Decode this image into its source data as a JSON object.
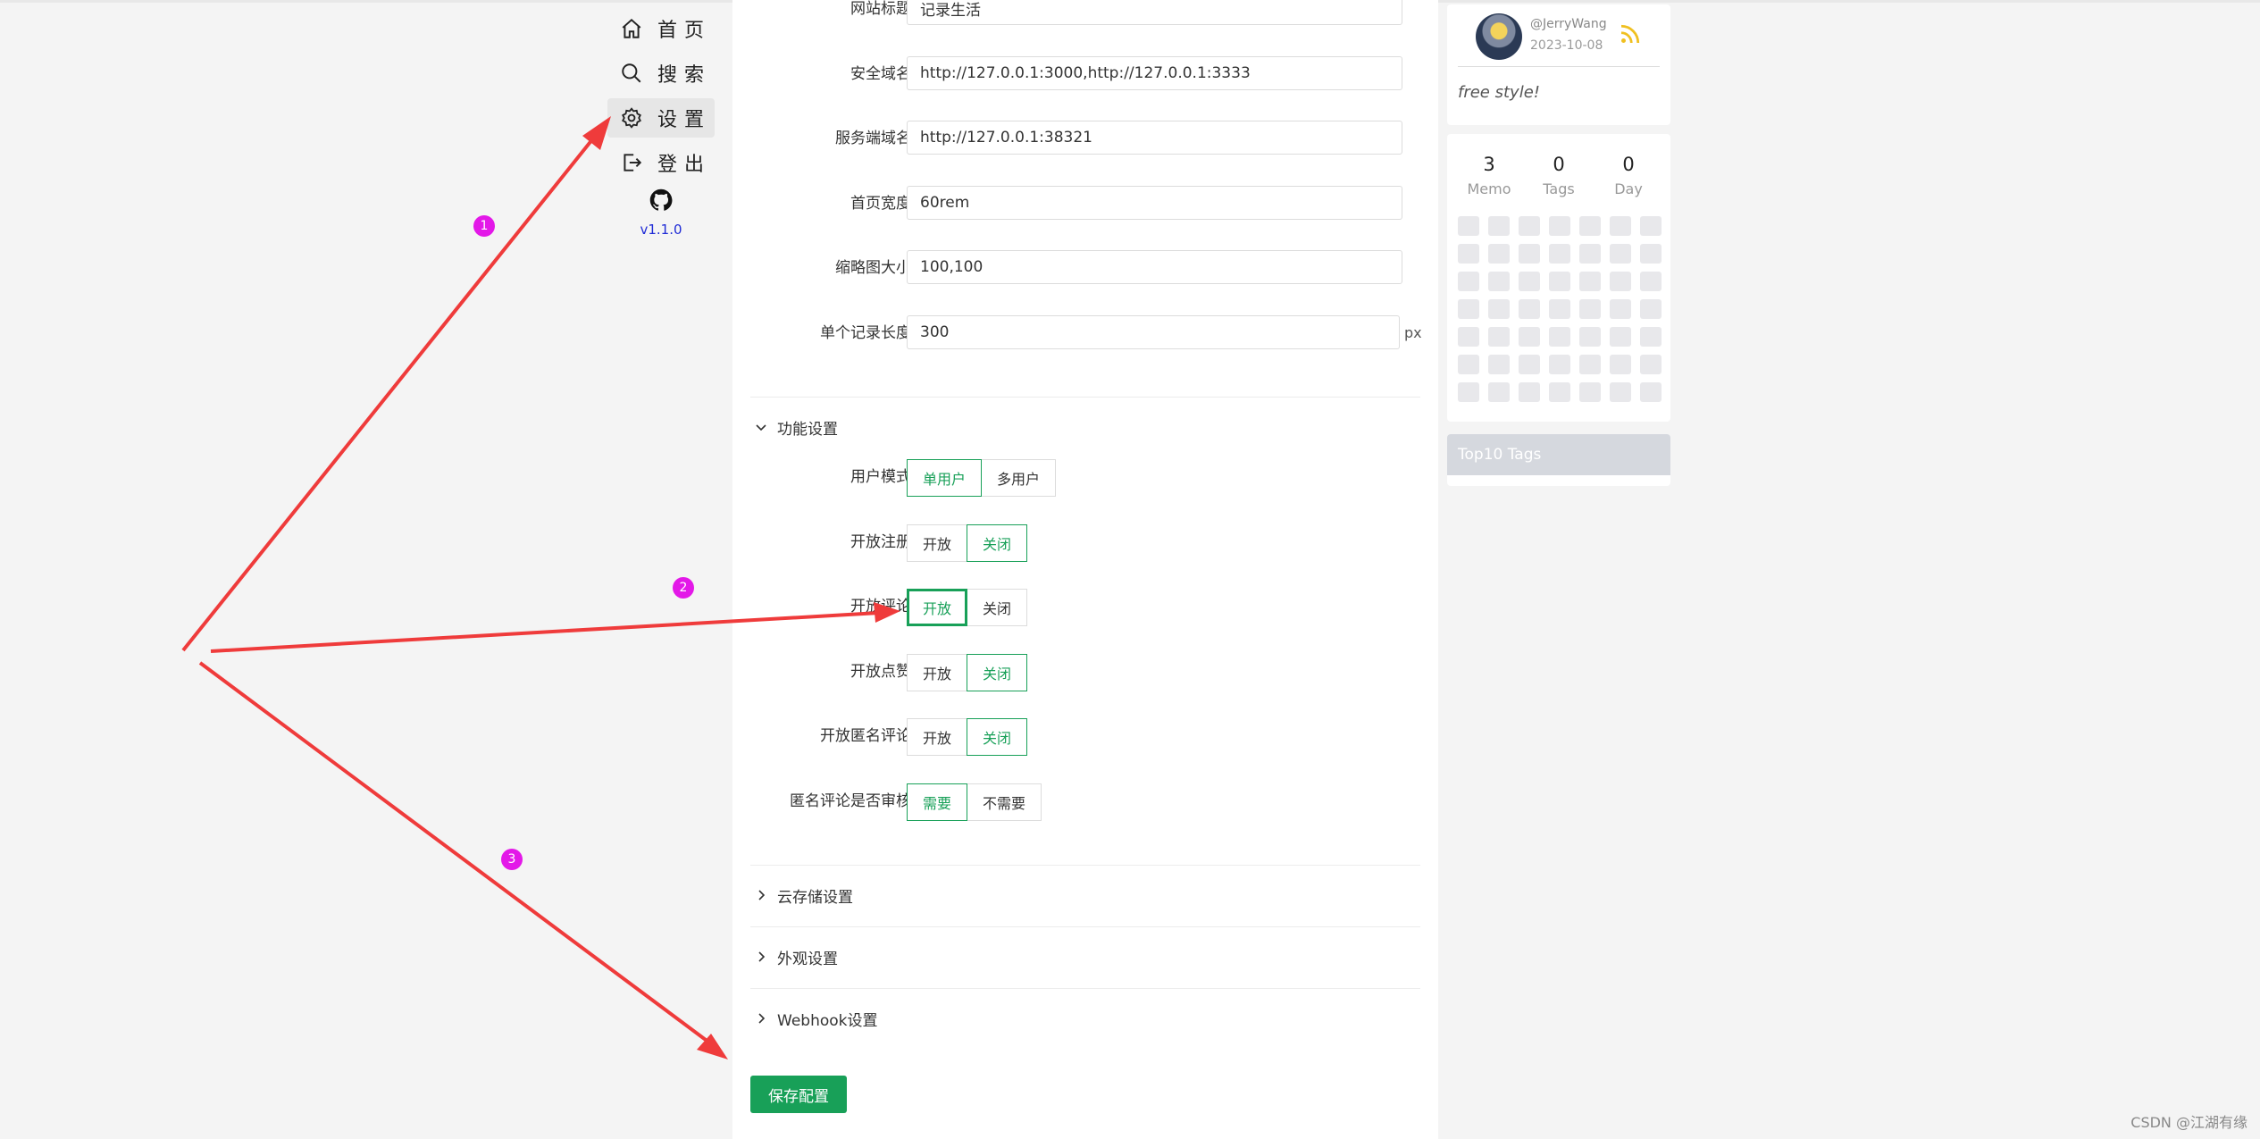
{
  "nav": {
    "items": [
      {
        "label": "首页",
        "icon": "home-icon"
      },
      {
        "label": "搜索",
        "icon": "search-icon"
      },
      {
        "label": "设置",
        "icon": "gear-icon",
        "active": true
      },
      {
        "label": "登出",
        "icon": "logout-icon"
      }
    ],
    "github_icon": "github-icon",
    "version": "v1.1.0"
  },
  "settings": {
    "fields": [
      {
        "label": "网站标题",
        "value": "记录生活"
      },
      {
        "label": "安全域名",
        "value": "http://127.0.0.1:3000,http://127.0.0.1:3333"
      },
      {
        "label": "服务端域名",
        "value": "http://127.0.0.1:38321"
      },
      {
        "label": "首页宽度",
        "value": "60rem"
      },
      {
        "label": "缩略图大小",
        "value": "100,100"
      },
      {
        "label": "单个记录长度",
        "value": "300",
        "unit": "px"
      }
    ],
    "feature_section": "功能设置",
    "toggles": [
      {
        "label": "用户模式",
        "options": [
          "单用户",
          "多用户"
        ],
        "selected": 0
      },
      {
        "label": "开放注册",
        "options": [
          "开放",
          "关闭"
        ],
        "selected": 1
      },
      {
        "label": "开放评论",
        "options": [
          "开放",
          "关闭"
        ],
        "selected": 0
      },
      {
        "label": "开放点赞",
        "options": [
          "开放",
          "关闭"
        ],
        "selected": 1
      },
      {
        "label": "开放匿名评论",
        "options": [
          "开放",
          "关闭"
        ],
        "selected": 1
      },
      {
        "label": "匿名评论是否审核",
        "options": [
          "需要",
          "不需要"
        ],
        "selected": 0
      }
    ],
    "collapsed_sections": [
      "云存储设置",
      "外观设置",
      "Webhook设置"
    ],
    "save_label": "保存配置"
  },
  "profile": {
    "username": "@JerryWang",
    "date": "2023-10-08",
    "motto": "free style!"
  },
  "stats": {
    "items": [
      {
        "value": "3",
        "label": "Memo"
      },
      {
        "value": "0",
        "label": "Tags"
      },
      {
        "value": "0",
        "label": "Day"
      }
    ]
  },
  "tags": {
    "title": "Top10 Tags"
  },
  "annotations": {
    "badges": [
      "1",
      "2",
      "3"
    ],
    "arrow_color": "#ef3b3b",
    "badge_color": "#e318e8"
  },
  "accent_color": "#18a058",
  "watermark": "CSDN @江湖有缘"
}
